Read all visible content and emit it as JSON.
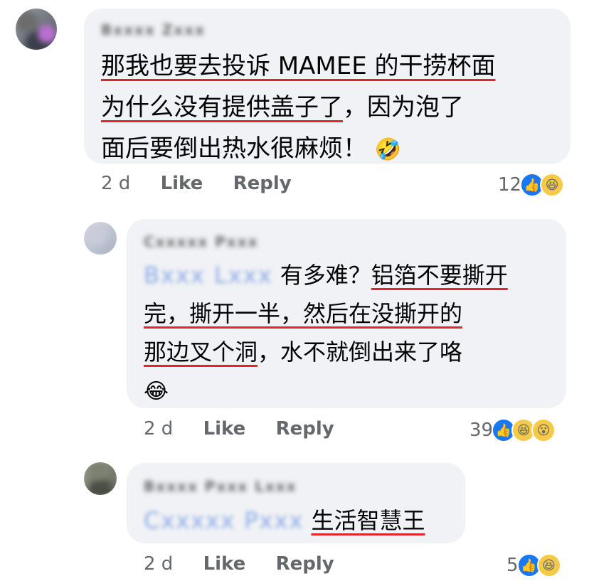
{
  "comments": [
    {
      "author": "Bxxxx Zxxx",
      "text_parts": [
        {
          "t": "那我也要去投诉 MAMEE 的干捞杯面",
          "u": true,
          "br": true
        },
        {
          "t": "为什么没有提供盖子了",
          "u": true
        },
        {
          "t": "，因为泡了",
          "u": false,
          "br": true
        },
        {
          "t": "面后要倒出热水很麻烦！",
          "u": false
        }
      ],
      "emoji": "🤣",
      "time": "2 d",
      "like_label": "Like",
      "reply_label": "Reply",
      "reaction_count": "12"
    },
    {
      "author": "Cxxxxx Pxxx",
      "mention": "Bxxx Lxxx",
      "text_parts": [
        {
          "t": " 有多难？",
          "u": false
        },
        {
          "t": "铝箔不要撕开",
          "u": true,
          "br": true
        },
        {
          "t": "完，撕开一半，然后在没撕开的",
          "u": true,
          "br": true
        },
        {
          "t": "那边叉个洞",
          "u": true
        },
        {
          "t": "，水不就倒出来了咯",
          "u": false
        }
      ],
      "emoji": "😂",
      "time": "2 d",
      "like_label": "Like",
      "reply_label": "Reply",
      "reaction_count": "39"
    },
    {
      "author": "Bxxxx Pxxx Lxxx",
      "mention": "Cxxxxx Pxxx",
      "text_parts": [
        {
          "t": " ",
          "u": false
        },
        {
          "t": "生活智慧王",
          "u": true
        }
      ],
      "time": "2 d",
      "like_label": "Like",
      "reply_label": "Reply",
      "reaction_count": "5"
    }
  ],
  "icons": {
    "like": "thumbs-up-icon",
    "haha": "laughing-face-icon",
    "wow": "surprised-face-icon"
  },
  "colors": {
    "bubble": "#f0f2f5",
    "underline": "#e0262b",
    "like_blue": "#1877f2",
    "meta_gray": "#65676b"
  }
}
